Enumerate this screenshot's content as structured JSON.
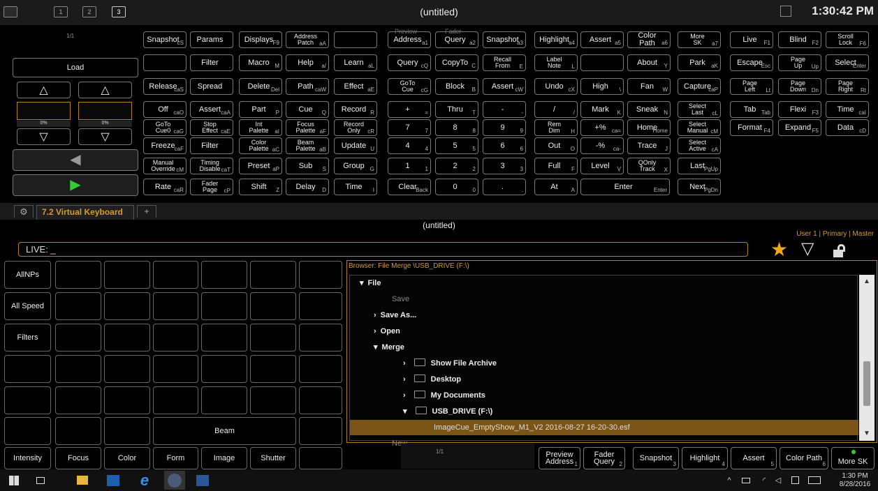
{
  "window": {
    "title": "(untitled)",
    "clock": "1:30:42 PM",
    "desk_buttons": [
      "1",
      "2",
      "3"
    ]
  },
  "fader_panel": {
    "page": "1/1",
    "load": "Load",
    "percent_left": "0%",
    "percent_right": "0%"
  },
  "keyboard": {
    "c1": [
      {
        "l": "Snapshot",
        "s": "cS"
      },
      {
        "l": "",
        "s": ""
      },
      {
        "l": "Release",
        "s": "caS"
      },
      {
        "l": "Off",
        "s": "caO"
      },
      {
        "l": "GoTo\nCue0",
        "s": "caG"
      },
      {
        "l": "Freeze",
        "s": "caF"
      },
      {
        "l": "Manual\nOverride",
        "s": "cM"
      },
      {
        "l": "Rate",
        "s": "caR"
      }
    ],
    "c2": [
      {
        "l": "Params",
        "s": ""
      },
      {
        "l": "Filter",
        "s": "."
      },
      {
        "l": "Spread",
        "s": ""
      },
      {
        "l": "Assert",
        "s": "caA"
      },
      {
        "l": "Stop\nEffect",
        "s": "caE"
      },
      {
        "l": "Filter",
        "s": ""
      },
      {
        "l": "Timing\nDisable",
        "s": "caT"
      },
      {
        "l": "Fader\nPage",
        "s": "cP"
      }
    ],
    "c3": [
      {
        "l": "Displays",
        "s": "F9"
      },
      {
        "l": "Macro",
        "s": "M"
      },
      {
        "l": "Delete",
        "s": "Del"
      },
      {
        "l": "Part",
        "s": "P"
      },
      {
        "l": "Int\nPalette",
        "s": "aI"
      },
      {
        "l": "Color\nPalette",
        "s": "aC"
      },
      {
        "l": "Preset",
        "s": "aP"
      },
      {
        "l": "Shift",
        "s": "Z"
      }
    ],
    "c4": [
      {
        "l": "Address\nPatch",
        "s": "aA"
      },
      {
        "l": "Help",
        "s": "a/"
      },
      {
        "l": "Path",
        "s": "caW"
      },
      {
        "l": "Cue",
        "s": "Q"
      },
      {
        "l": "Focus\nPalette",
        "s": "aF"
      },
      {
        "l": "Beam\nPalette",
        "s": "aB"
      },
      {
        "l": "Sub",
        "s": "S"
      },
      {
        "l": "Delay",
        "s": "D"
      }
    ],
    "c5": [
      {
        "l": "",
        "s": ""
      },
      {
        "l": "Learn",
        "s": "aL"
      },
      {
        "l": "Effect",
        "s": "aE"
      },
      {
        "l": "Record",
        "s": "R"
      },
      {
        "l": "Record\nOnly",
        "s": "cR"
      },
      {
        "l": "Update",
        "s": "U"
      },
      {
        "l": "Group",
        "s": "G"
      },
      {
        "l": "Time",
        "s": "I"
      }
    ],
    "c6": [
      {
        "l": "Address",
        "s": "a1"
      },
      {
        "l": "Query",
        "s": "cQ"
      },
      {
        "l": "GoTo\nCue",
        "s": "cG"
      },
      {
        "l": "+",
        "s": "="
      },
      {
        "l": "7",
        "s": "7"
      },
      {
        "l": "4",
        "s": "4"
      },
      {
        "l": "1",
        "s": "1"
      },
      {
        "l": "Clear",
        "s": "Back"
      }
    ],
    "c7": [
      {
        "l": "Query",
        "s": "a2"
      },
      {
        "l": "CopyTo",
        "s": "C"
      },
      {
        "l": "Block",
        "s": "B"
      },
      {
        "l": "Thru",
        "s": "T"
      },
      {
        "l": "8",
        "s": "8"
      },
      {
        "l": "5",
        "s": "5"
      },
      {
        "l": "2",
        "s": "2"
      },
      {
        "l": "0",
        "s": "0"
      }
    ],
    "c8": [
      {
        "l": "Snapshot",
        "s": "a3"
      },
      {
        "l": "Recall\nFrom",
        "s": "E"
      },
      {
        "l": "Assert",
        "s": "cW"
      },
      {
        "l": "-",
        "s": "-"
      },
      {
        "l": "9",
        "s": "9"
      },
      {
        "l": "6",
        "s": "6"
      },
      {
        "l": "3",
        "s": "3"
      },
      {
        "l": ".",
        "s": "."
      }
    ],
    "c9": [
      {
        "l": "Highlight",
        "s": "a4"
      },
      {
        "l": "Label\nNote",
        "s": "L"
      },
      {
        "l": "Undo",
        "s": "cX"
      },
      {
        "l": "/",
        "s": "/"
      },
      {
        "l": "Rem\nDim",
        "s": "H"
      },
      {
        "l": "Out",
        "s": "O"
      },
      {
        "l": "Full",
        "s": "F"
      },
      {
        "l": "At",
        "s": "A"
      }
    ],
    "c10": [
      {
        "l": "Assert",
        "s": "a5"
      },
      {
        "l": "",
        "s": ""
      },
      {
        "l": "High",
        "s": "\\"
      },
      {
        "l": "Mark",
        "s": "K"
      },
      {
        "l": "+%",
        "s": "ca="
      },
      {
        "l": "-%",
        "s": "ca-"
      },
      {
        "l": "Level",
        "s": "V"
      },
      {
        "l": "Enter",
        "s": "Enter"
      }
    ],
    "c11": [
      {
        "l": "Color Path",
        "s": "a6"
      },
      {
        "l": "About",
        "s": "Y"
      },
      {
        "l": "Fan",
        "s": "W"
      },
      {
        "l": "Sneak",
        "s": "N"
      },
      {
        "l": "Home",
        "s": "Home"
      },
      {
        "l": "Trace",
        "s": "J"
      },
      {
        "l": "QOnly\nTrack",
        "s": "X"
      }
    ],
    "c12": [
      {
        "l": "More\nSK",
        "s": "a7"
      },
      {
        "l": "Park",
        "s": "aK"
      },
      {
        "l": "Capture",
        "s": "caP"
      },
      {
        "l": "Select\nLast",
        "s": "cL"
      },
      {
        "l": "Select\nManual",
        "s": "cM"
      },
      {
        "l": "Select\nActive",
        "s": "cA"
      },
      {
        "l": "Last",
        "s": "PgUp"
      },
      {
        "l": "Next",
        "s": "PgDn"
      }
    ],
    "c13": [
      {
        "l": "Live",
        "s": "F1"
      },
      {
        "l": "Escape",
        "s": "Esc"
      },
      {
        "l": "Page\nLeft",
        "s": "Lt"
      },
      {
        "l": "Tab",
        "s": "Tab"
      },
      {
        "l": "Format",
        "s": "F4"
      }
    ],
    "c14": [
      {
        "l": "Blind",
        "s": "F2"
      },
      {
        "l": "Page\nUp",
        "s": "Up"
      },
      {
        "l": "Page\nDown",
        "s": "Dn"
      },
      {
        "l": "Flexi",
        "s": "F3"
      },
      {
        "l": "Expand",
        "s": "F5"
      }
    ],
    "c15": [
      {
        "l": "Scroll\nLock",
        "s": "F6"
      },
      {
        "l": "Select",
        "s": "Enter"
      },
      {
        "l": "Page\nRight",
        "s": "Rt"
      },
      {
        "l": "Time",
        "s": "caI"
      },
      {
        "l": "Data",
        "s": "cD"
      }
    ],
    "top_headers": {
      "preview": "Preview",
      "fader": "Fader"
    }
  },
  "tabs": {
    "settings_icon": "gear-icon",
    "active": "7.2 Virtual Keyboard",
    "add": "+"
  },
  "cmd": {
    "title": "(untitled)",
    "user": "User 1 | Primary | Master",
    "live": "LIVE: _"
  },
  "magic_sheet": {
    "rows": [
      "AllNPs",
      "All Speed",
      "Filters",
      "",
      "",
      ""
    ],
    "beam": "Beam",
    "bottom": [
      "Intensity",
      "Focus",
      "Color",
      "Form",
      "Image",
      "Shutter"
    ]
  },
  "browser": {
    "header": "Browser: File Merge \\USB_DRIVE (F:\\)",
    "rows": [
      {
        "t": "File"
      },
      {
        "t": "Save"
      },
      {
        "t": "Save As..."
      },
      {
        "t": "Open"
      },
      {
        "t": "Merge"
      },
      {
        "t": "Show File Archive"
      },
      {
        "t": "Desktop"
      },
      {
        "t": "My Documents"
      },
      {
        "t": "USB_DRIVE (F:\\)"
      },
      {
        "t": "ImageCue_EmptyShow_M1_V2 2016-08-27 16-20-30.esf"
      },
      {
        "t": "New"
      }
    ]
  },
  "softkeys": {
    "page": "1/1",
    "keys": [
      {
        "l": "Preview\nAddress",
        "s": "1"
      },
      {
        "l": "Fader\nQuery",
        "s": "2"
      },
      {
        "l": "Snapshot",
        "s": "3"
      },
      {
        "l": "Highlight",
        "s": "4"
      },
      {
        "l": "Assert",
        "s": "5"
      },
      {
        "l": "Color Path",
        "s": "6"
      },
      {
        "l": "More SK",
        "s": ""
      }
    ]
  },
  "taskbar": {
    "time": "1:30 PM",
    "date": "8/28/2016",
    "colors": {
      "accent": "#b58214",
      "selection": "#7a5416"
    }
  }
}
